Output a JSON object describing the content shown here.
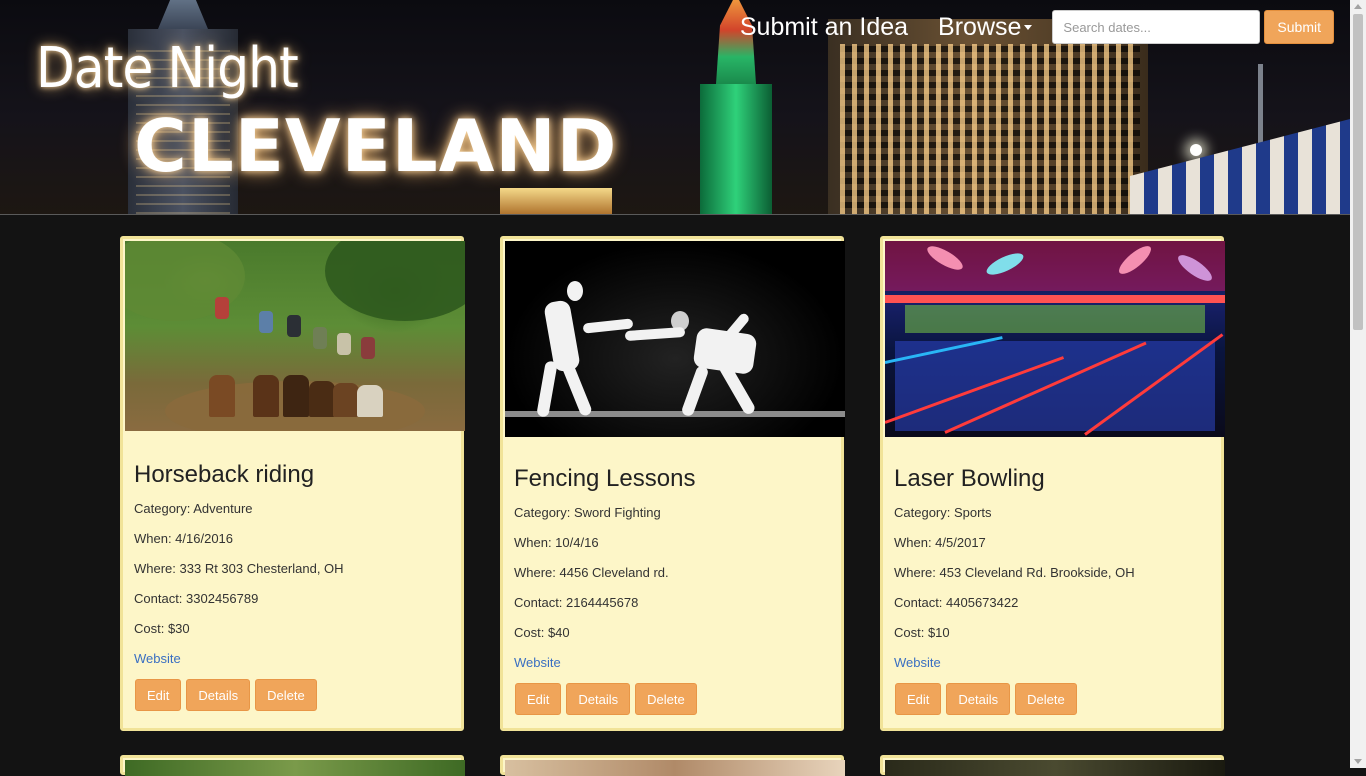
{
  "header": {
    "logo_line1": "Date Night",
    "logo_line2": "CLEVELAND"
  },
  "nav": {
    "submit_idea": "Submit an Idea",
    "browse": "Browse",
    "search_placeholder": "Search dates...",
    "submit_button": "Submit"
  },
  "cards": [
    {
      "title": "Horseback riding",
      "category": "Category: Adventure",
      "when": "When: 4/16/2016",
      "where": "Where: 333 Rt 303 Chesterland, OH",
      "contact": "Contact: 3302456789",
      "cost": "Cost: $30",
      "website": "Website",
      "edit": "Edit",
      "details": "Details",
      "delete": "Delete"
    },
    {
      "title": "Fencing Lessons",
      "category": "Category: Sword Fighting",
      "when": "When: 10/4/16",
      "where": "Where: 4456 Cleveland rd.",
      "contact": "Contact: 2164445678",
      "cost": "Cost: $40",
      "website": "Website",
      "edit": "Edit",
      "details": "Details",
      "delete": "Delete"
    },
    {
      "title": "Laser Bowling",
      "category": "Category: Sports",
      "when": "When: 4/5/2017",
      "where": "Where: 453 Cleveland Rd. Brookside, OH",
      "contact": "Contact: 4405673422",
      "cost": "Cost: $10",
      "website": "Website",
      "edit": "Edit",
      "details": "Details",
      "delete": "Delete"
    }
  ],
  "colors": {
    "accent": "#f0a55a",
    "card_bg": "#fdf6c8",
    "link": "#3a6fc2",
    "page_bg": "#131313"
  }
}
